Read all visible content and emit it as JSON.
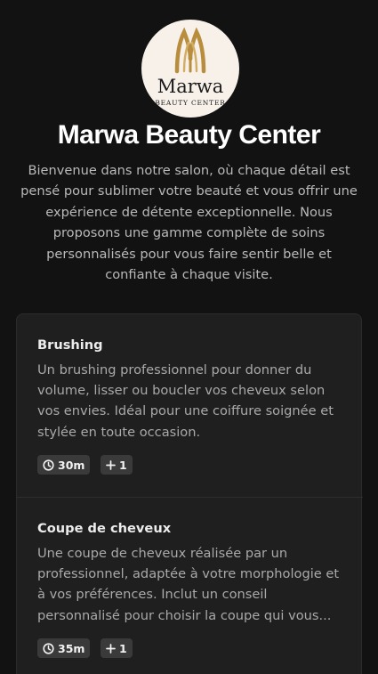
{
  "brand": {
    "logo_text": "Marwa",
    "logo_subtext": "BEAUTY CENTER",
    "title": "Marwa Beauty Center",
    "intro": "Bienvenue dans notre salon, où chaque détail est pensé pour sublimer votre beauté et vous offrir une expérience de détente exceptionnelle. Nous proposons une gamme complète de soins personnalisés pour vous faire sentir belle et confiante à chaque visite."
  },
  "services": [
    {
      "name": "Brushing",
      "description": "Un brushing professionnel pour donner du volume, lisser ou boucler vos cheveux selon vos envies. Idéal pour une coiffure soignée et stylée en toute occasion.",
      "duration": "30m",
      "extra": "1",
      "duration_icon": "clock-icon",
      "extra_icon": "plus-icon"
    },
    {
      "name": "Coupe de cheveux",
      "description": "Une coupe de cheveux réalisée par un professionnel, adaptée à votre morphologie et à vos préférences. Inclut un conseil personnalisé pour choisir la coupe qui vous...",
      "duration": "35m",
      "extra": "1",
      "duration_icon": "clock-icon",
      "extra_icon": "plus-icon"
    }
  ],
  "colors": {
    "background": "#121212",
    "card": "#1f1f1f",
    "badge": "#3a3a3a",
    "logo_gold": "#b98d3e",
    "logo_bg": "#f7f1ea"
  }
}
